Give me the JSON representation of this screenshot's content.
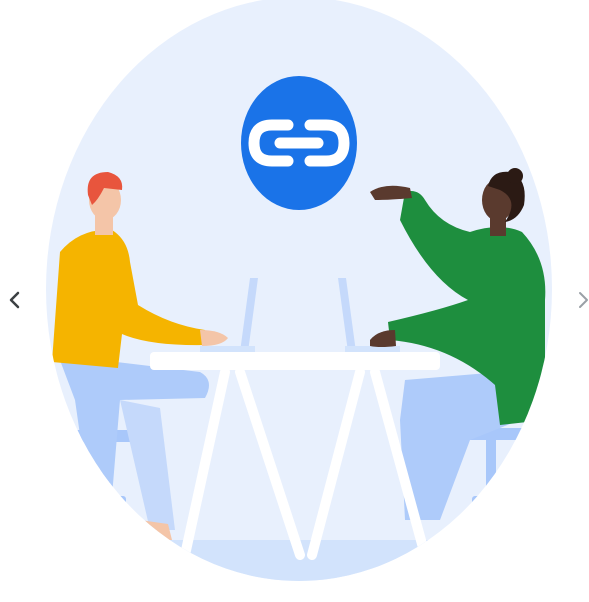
{
  "carousel": {
    "prev_icon": "chevron-left-icon",
    "next_icon": "chevron-right-icon",
    "slide": {
      "illustration": "two-people-sharing-link-at-table",
      "badge_icon": "link-icon"
    }
  },
  "colors": {
    "ellipse_background": "#e8f0fd",
    "link_badge": "#1a73e8",
    "person_left_shirt": "#f5b400",
    "person_left_hair": "#e8553d",
    "person_right_shirt": "#1e8e3e",
    "person_right_skin": "#5a3a2e",
    "pants": "#aecbfa",
    "table": "#ffffff",
    "chair": "#a8c7fa",
    "prev_arrow": "#3c4043",
    "next_arrow": "#9aa0a6"
  }
}
